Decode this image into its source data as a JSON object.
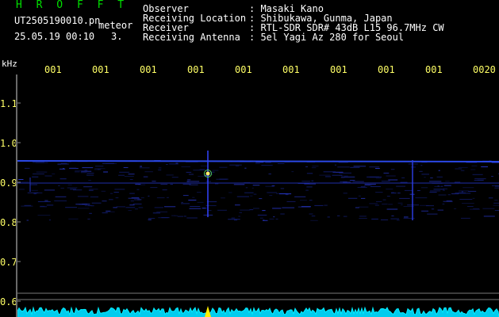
{
  "header": {
    "app_title": "H R O F F T",
    "filename": "UT2505190010.pn",
    "meteor_tag": "meteor",
    "timestamp": "25.05.19 00:10",
    "count": "3."
  },
  "info": [
    {
      "key": "Observer",
      "value": ": Masaki Kano"
    },
    {
      "key": "Receiving Location",
      "value": ": Shibukawa, Gunma, Japan"
    },
    {
      "key": "Receiver",
      "value": ": RTL-SDR SDR# 43dB L15 96.7MHz CW"
    },
    {
      "key": "Receiving Antenna",
      "value": ": 5el Yagi Az 280 for Seoul"
    }
  ],
  "axis": {
    "unit": "kHz",
    "time_labels": [
      "001",
      "001",
      "001",
      "001",
      "001",
      "001",
      "001",
      "001",
      "001",
      "0020"
    ],
    "freq_labels": [
      "1.1",
      "1.0",
      "0.9",
      "0.8",
      "0.7",
      "0.6"
    ]
  },
  "colors": {
    "background": "#000000",
    "title": "#00e000",
    "labels": "#ffff66",
    "signal": "#3344ff",
    "spectrum": "#00ddff",
    "peak": "#ffee00"
  }
}
